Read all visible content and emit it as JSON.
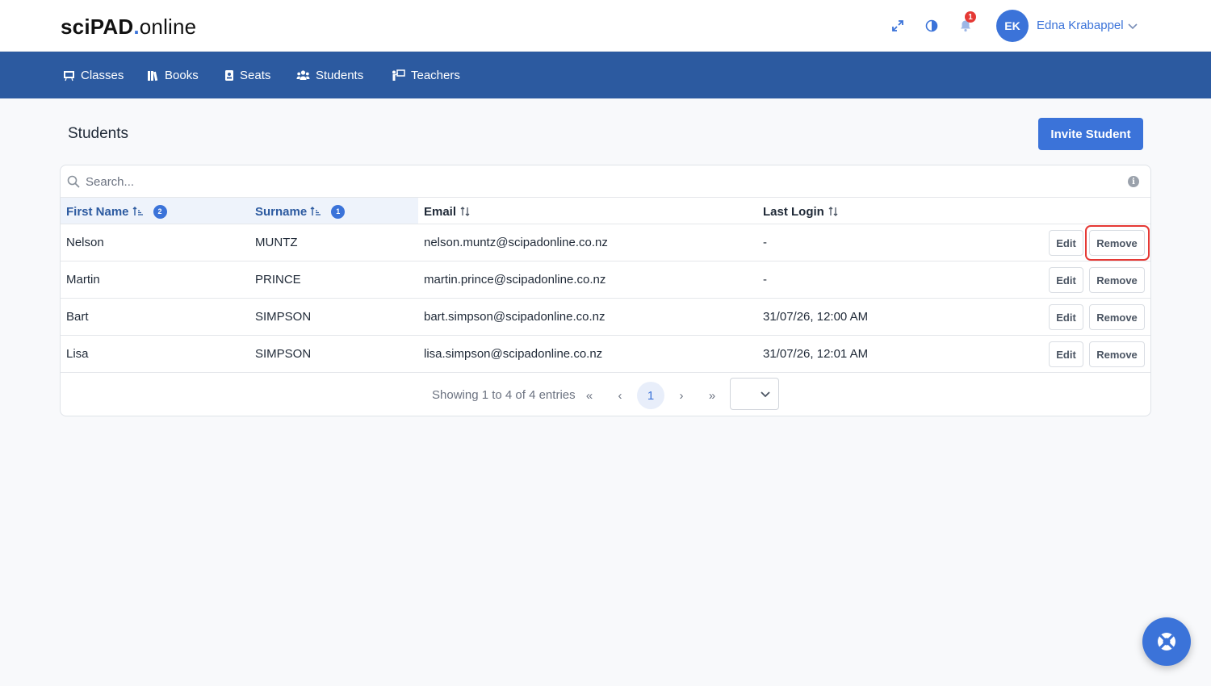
{
  "logo": {
    "part1": "sciPAD",
    "dot": ".",
    "part2": "online"
  },
  "header": {
    "notification_count": "1",
    "user": {
      "initials": "EK",
      "name": "Edna Krabappel"
    }
  },
  "nav": {
    "items": [
      {
        "label": "Classes",
        "icon": "easel-icon"
      },
      {
        "label": "Books",
        "icon": "books-icon"
      },
      {
        "label": "Seats",
        "icon": "badge-icon"
      },
      {
        "label": "Students",
        "icon": "users-icon"
      },
      {
        "label": "Teachers",
        "icon": "teacher-icon"
      }
    ]
  },
  "page": {
    "title": "Students",
    "invite_button": "Invite Student"
  },
  "search": {
    "placeholder": "Search..."
  },
  "table": {
    "columns": [
      {
        "label": "First Name",
        "sort_order": "2"
      },
      {
        "label": "Surname",
        "sort_order": "1"
      },
      {
        "label": "Email"
      },
      {
        "label": "Last Login"
      }
    ],
    "rows": [
      {
        "first": "Nelson",
        "surname": "MUNTZ",
        "email": "nelson.muntz@scipadonline.co.nz",
        "last_login": "-"
      },
      {
        "first": "Martin",
        "surname": "PRINCE",
        "email": "martin.prince@scipadonline.co.nz",
        "last_login": "-"
      },
      {
        "first": "Bart",
        "surname": "SIMPSON",
        "email": "bart.simpson@scipadonline.co.nz",
        "last_login": "31/07/26, 12:00 AM"
      },
      {
        "first": "Lisa",
        "surname": "SIMPSON",
        "email": "lisa.simpson@scipadonline.co.nz",
        "last_login": "31/07/26, 12:01 AM"
      }
    ],
    "edit_label": "Edit",
    "remove_label": "Remove"
  },
  "pagination": {
    "summary": "Showing 1 to 4 of 4 entries",
    "current_page": "1",
    "first": "«",
    "prev": "‹",
    "next": "›",
    "last": "»"
  },
  "colors": {
    "primary": "#3b73d9",
    "nav": "#2c5aa0",
    "highlight": "#e53935"
  }
}
